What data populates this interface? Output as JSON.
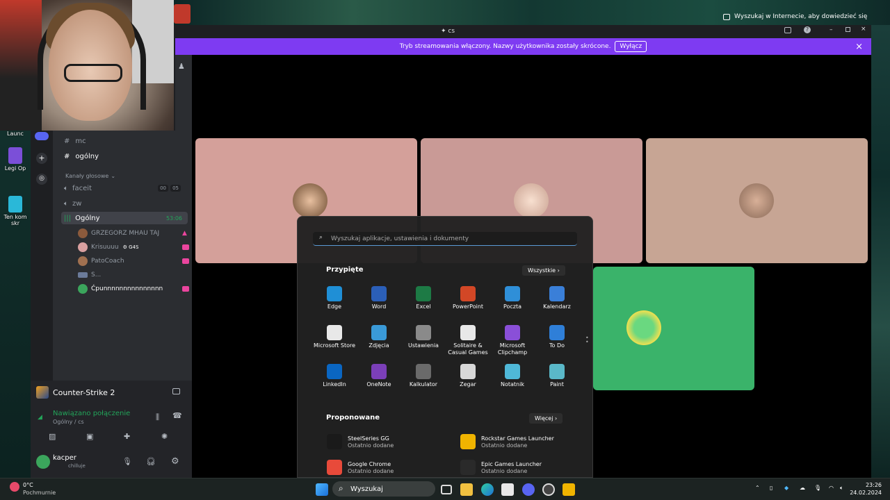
{
  "desktop": {
    "icons": [
      {
        "label": "Launc"
      },
      {
        "label": "Legi Op"
      },
      {
        "label": "Ten kom skr"
      }
    ],
    "search_hint": "Wyszukaj w Internecie, aby dowiedzieć się"
  },
  "window": {
    "title": "cs",
    "banner_text": "Tryb streamowania włączony. Nazwy użytkownika zostały skrócone.",
    "banner_button": "Wyłącz"
  },
  "channels": {
    "text": [
      {
        "name": "mc"
      },
      {
        "name": "ogólny"
      }
    ],
    "voice_category": "Kanały głosowe",
    "voice": [
      {
        "name": "faceit",
        "badge1": "00",
        "badge2": "05"
      },
      {
        "name": "zw"
      },
      {
        "name": "Ogólny",
        "timer": "53:06"
      }
    ],
    "voice_users": [
      {
        "name": "GRZEGORZ MHAU TAJ",
        "color": "#8b5a3c"
      },
      {
        "name": "Krisuuuu",
        "tag": "G4S",
        "color": "#d9a0a0"
      },
      {
        "name": "PatoCoach",
        "color": "#a07050"
      },
      {
        "name": "S...",
        "color": "#6b7b9a"
      },
      {
        "name": "Ćpunnnnnnnnnnnnnnn",
        "color": "#3ba55c"
      }
    ]
  },
  "activity": {
    "game": "Counter-Strike 2",
    "status": "Nawiązano połączenie",
    "channel": "Ogólny / cs"
  },
  "user": {
    "name": "kacper",
    "status": "chilluje"
  },
  "stage": {
    "tiles": [
      {
        "bg": "#d4a09a"
      },
      {
        "bg": "#c99a96"
      },
      {
        "bg": "#c7a594"
      },
      {
        "bg": "#3ab36a"
      }
    ]
  },
  "start_menu": {
    "search_placeholder": "Wyszukaj aplikacje, ustawienia i dokumenty",
    "pinned_title": "Przypięte",
    "all_button": "Wszystkie",
    "pinned": [
      {
        "label": "Edge",
        "icon": "edge-icon",
        "color": "#1f8fd6"
      },
      {
        "label": "Word",
        "icon": "word-icon",
        "color": "#2b5fb8"
      },
      {
        "label": "Excel",
        "icon": "excel-icon",
        "color": "#1d7a45"
      },
      {
        "label": "PowerPoint",
        "icon": "powerpoint-icon",
        "color": "#d24726"
      },
      {
        "label": "Poczta",
        "icon": "mail-icon",
        "color": "#2f8fd8"
      },
      {
        "label": "Kalendarz",
        "icon": "calendar-icon",
        "color": "#3a7fd8"
      },
      {
        "label": "Microsoft Store",
        "icon": "store-icon",
        "color": "#e8e8e8"
      },
      {
        "label": "Zdjęcia",
        "icon": "photos-icon",
        "color": "#3a9ad8"
      },
      {
        "label": "Ustawienia",
        "icon": "settings-icon",
        "color": "#8a8a8a"
      },
      {
        "label": "Solitaire & Casual Games",
        "icon": "solitaire-icon",
        "color": "#e8e8e8"
      },
      {
        "label": "Microsoft Clipchamp",
        "icon": "clipchamp-icon",
        "color": "#8a4fd8"
      },
      {
        "label": "To Do",
        "icon": "todo-icon",
        "color": "#2f7fd8"
      },
      {
        "label": "LinkedIn",
        "icon": "linkedin-icon",
        "color": "#0a66c2"
      },
      {
        "label": "OneNote",
        "icon": "onenote-icon",
        "color": "#7b3fb8"
      },
      {
        "label": "Kalkulator",
        "icon": "calculator-icon",
        "color": "#6a6a6a"
      },
      {
        "label": "Zegar",
        "icon": "clock-icon",
        "color": "#d8d8d8"
      },
      {
        "label": "Notatnik",
        "icon": "notepad-icon",
        "color": "#4fb8d8"
      },
      {
        "label": "Paint",
        "icon": "paint-icon",
        "color": "#5ab8c8"
      }
    ],
    "recommended_title": "Proponowane",
    "more_button": "Więcej",
    "recommended": [
      {
        "name": "SteelSeries GG",
        "sub": "Ostatnio dodane",
        "icon": "steelseries-icon",
        "color": "#1a1a1a"
      },
      {
        "name": "Rockstar Games Launcher",
        "sub": "Ostatnio dodane",
        "icon": "rockstar-icon",
        "color": "#f0b400"
      },
      {
        "name": "Google Chrome",
        "sub": "Ostatnio dodane",
        "icon": "chrome-icon",
        "color": "#e84a3a"
      },
      {
        "name": "Epic Games Launcher",
        "sub": "Ostatnio dodane",
        "icon": "epic-icon",
        "color": "#2a2a2a"
      }
    ]
  },
  "taskbar": {
    "weather_temp": "0°C",
    "weather_desc": "Pochmurnie",
    "search_label": "Wyszukaj",
    "time": "23:26",
    "date": "24.02.2024"
  }
}
